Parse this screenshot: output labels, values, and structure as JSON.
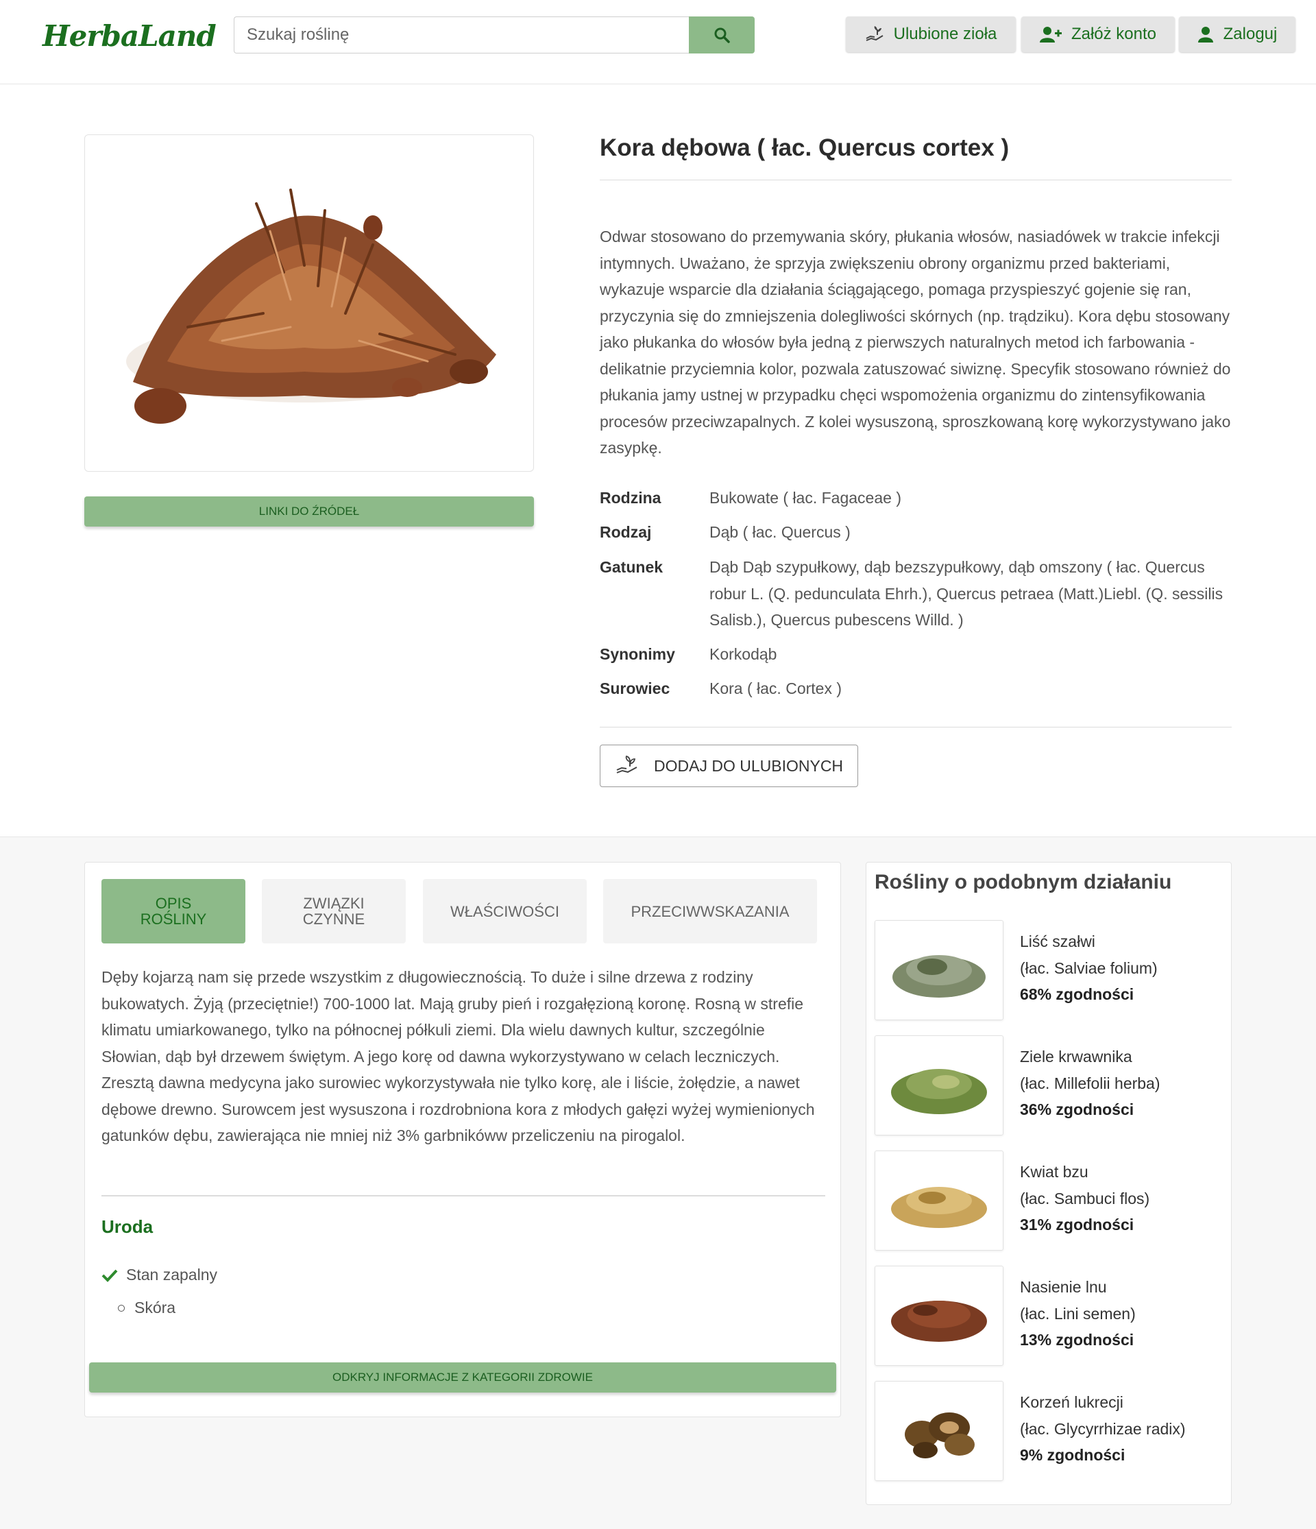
{
  "header": {
    "logo_text": "HerbaLand",
    "search_placeholder": "Szukaj roślinę",
    "fav_label": "Ulubione zioła",
    "register_label": "Załóż konto",
    "login_label": "Zaloguj"
  },
  "plant": {
    "title": "Kora dębowa ( łac. Quercus cortex )",
    "sources_label": "LINKI DO ŹRÓDEŁ",
    "description": "Odwar stosowano do przemywania skóry, płukania włosów, nasiadówek w trakcie infekcji intymnych. Uważano, że sprzyja zwiększeniu obrony organizmu przed bakteriami, wykazuje wsparcie dla działania ściągającego, pomaga przyspieszyć gojenie się ran, przyczynia się do zmniejszenia dolegliwości skórnych (np. trądziku). Kora dębu stosowany jako płukanka do włosów była jedną z pierwszych naturalnych metod ich farbowania - delikatnie przyciemnia kolor, pozwala zatuszować siwiznę. Specyfik stosowano również do płukania jamy ustnej w przypadku chęci wspomożenia organizmu do zintensyfikowania procesów przeciwzapalnych. Z kolei wysuszoną, sproszkowaną korę wykorzystywano jako zasypkę.",
    "info": [
      {
        "label": "Rodzina",
        "value": "Bukowate ( łac. Fagaceae )"
      },
      {
        "label": "Rodzaj",
        "value": "Dąb ( łac. Quercus )"
      },
      {
        "label": "Gatunek",
        "value": "Dąb Dąb szypułkowy, dąb bezszypułkowy, dąb omszony ( łac. Quercus robur L. (Q. pedunculata Ehrh.), Quercus petraea (Matt.)Liebl. (Q. sessilis Salisb.), Quercus pubescens Willd. )"
      },
      {
        "label": "Synonimy",
        "value": "Korkodąb"
      },
      {
        "label": "Surowiec",
        "value": "Kora ( łac. Cortex )"
      }
    ],
    "add_fav_label": "DODAJ DO ULUBIONYCH"
  },
  "tabs": [
    {
      "label": "OPIS ROŚLINY",
      "active": true
    },
    {
      "label": "ZWIĄZKI CZYNNE",
      "active": false
    },
    {
      "label": "WŁAŚCIWOŚCI",
      "active": false
    },
    {
      "label": "PRZECIWWSKAZANIA",
      "active": false
    }
  ],
  "tab_content": {
    "text": "Dęby kojarzą nam się przede wszystkim z długowiecznością. To duże i silne drzewa z rodziny bukowatych. Żyją (przeciętnie!) 700-1000 lat. Mają gruby pień i rozgałęzioną koronę. Rosną w strefie klimatu umiarkowanego, tylko na północnej półkuli ziemi. Dla wielu dawnych kultur, szczególnie Słowian, dąb był drzewem świętym. A jego korę od dawna wykorzystywano w celach leczniczych. Zresztą dawna medycyna jako surowiec wykorzystywała nie tylko korę, ale i liście, żołędzie, a nawet dębowe drewno. Surowcem jest wysuszona i rozdrobniona kora z młodych gałęzi wyżej wymienionych gatunków dębu, zawierająca nie mniej niż 3% garbnikóww przeliczeniu na pirogalol.",
    "category": "Uroda",
    "checked_item": "Stan zapalny",
    "sub_item": "Skóra",
    "health_btn": "ODKRYJ INFORMACJE Z KATEGORII ZDROWIE"
  },
  "similar": {
    "title": "Rośliny o podobnym działaniu",
    "items": [
      {
        "name": "Liść szałwi",
        "latin": "(łac. Salviae folium)",
        "match": "68% zgodności",
        "color": "#7d8a6a"
      },
      {
        "name": "Ziele krwawnika",
        "latin": "(łac. Millefolii herba)",
        "match": "36% zgodności",
        "color": "#6e8a3e"
      },
      {
        "name": "Kwiat bzu",
        "latin": "(łac. Sambuci flos)",
        "match": "31% zgodności",
        "color": "#c9a45a"
      },
      {
        "name": "Nasienie lnu",
        "latin": "(łac. Lini semen)",
        "match": "13% zgodności",
        "color": "#7a3b22"
      },
      {
        "name": "Korzeń lukrecji",
        "latin": "(łac. Glycyrrhizae radix)",
        "match": "9% zgodności",
        "color": "#6b4a22"
      }
    ]
  },
  "colors": {
    "accent_green": "#8dba89",
    "dark_green": "#1b6f1f"
  }
}
